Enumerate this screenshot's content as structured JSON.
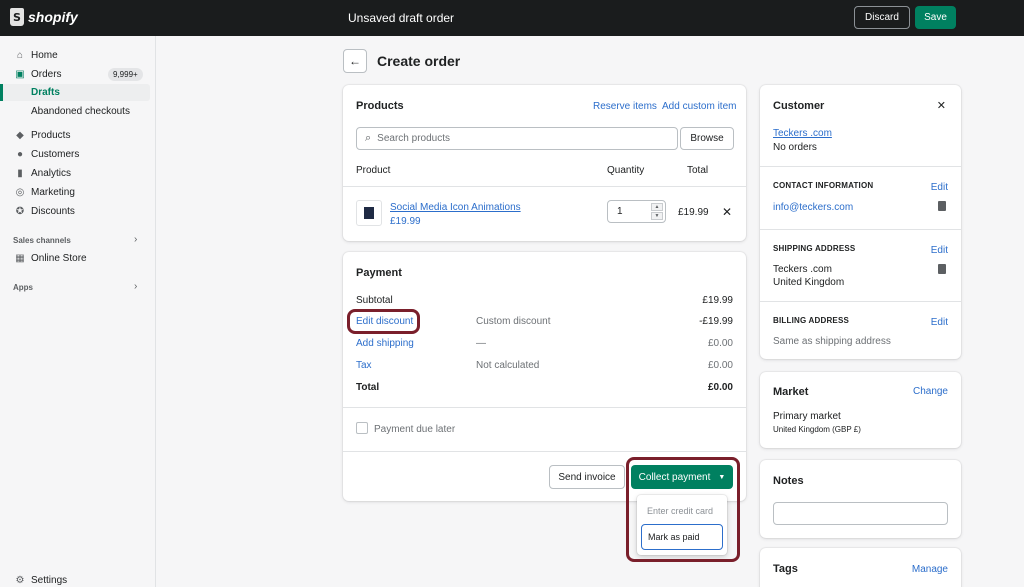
{
  "topbar": {
    "brand": "shopify",
    "title": "Unsaved draft order",
    "discard_label": "Discard",
    "save_label": "Save"
  },
  "sidebar": {
    "home": "Home",
    "orders": "Orders",
    "orders_badge": "9,999+",
    "drafts": "Drafts",
    "abandoned": "Abandoned checkouts",
    "products": "Products",
    "customers": "Customers",
    "analytics": "Analytics",
    "marketing": "Marketing",
    "discounts": "Discounts",
    "sales_channels": "Sales channels",
    "online_store": "Online Store",
    "apps": "Apps",
    "settings": "Settings"
  },
  "page": {
    "title": "Create order"
  },
  "products_card": {
    "title": "Products",
    "reserve_items": "Reserve items",
    "add_custom_item": "Add custom item",
    "search_placeholder": "Search products",
    "browse_label": "Browse",
    "col_product": "Product",
    "col_quantity": "Quantity",
    "col_total": "Total",
    "item_name": "Social Media Icon Animations",
    "item_price": "£19.99",
    "item_quantity": "1",
    "item_total": "£19.99"
  },
  "payment_card": {
    "title": "Payment",
    "subtotal_label": "Subtotal",
    "subtotal_value": "£19.99",
    "discount_label": "Edit discount",
    "discount_desc": "Custom discount",
    "discount_value": "-£19.99",
    "shipping_label": "Add shipping",
    "shipping_desc": "—",
    "shipping_value": "£0.00",
    "tax_label": "Tax",
    "tax_desc": "Not calculated",
    "tax_value": "£0.00",
    "total_label": "Total",
    "total_value": "£0.00",
    "payment_due_later": "Payment due later",
    "send_invoice": "Send invoice",
    "collect_payment": "Collect payment",
    "dropdown_items": [
      "Enter credit card",
      "Mark as paid"
    ]
  },
  "customer_card": {
    "title": "Customer",
    "customer_name": "Teckers .com",
    "orders_count": "No orders",
    "contact_label": "CONTACT INFORMATION",
    "contact_edit": "Edit",
    "contact_email": "info@teckers.com",
    "shipping_label": "SHIPPING ADDRESS",
    "shipping_edit": "Edit",
    "shipping_name": "Teckers .com",
    "shipping_country": "United Kingdom",
    "billing_label": "BILLING ADDRESS",
    "billing_edit": "Edit",
    "billing_value": "Same as shipping address"
  },
  "market_card": {
    "title": "Market",
    "change": "Change",
    "market_name": "Primary market",
    "market_detail": "United Kingdom (GBP £)"
  },
  "notes_card": {
    "title": "Notes"
  },
  "tags_card": {
    "title": "Tags",
    "manage": "Manage"
  },
  "colors": {
    "accent_green": "#008060",
    "link_blue": "#2c6ecb",
    "annotation_red": "#7a1f2b"
  }
}
